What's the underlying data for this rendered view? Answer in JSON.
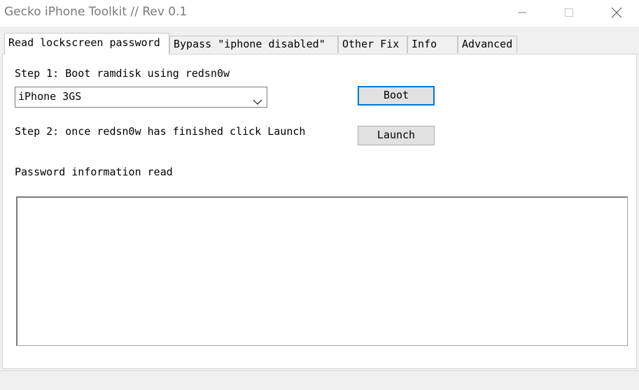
{
  "window": {
    "title": "Gecko iPhone Toolkit // Rev 0.1"
  },
  "tabs": [
    {
      "label": "Read lockscreen password",
      "active": true
    },
    {
      "label": "Bypass \"iphone disabled\"",
      "active": false
    },
    {
      "label": "Other Fix",
      "active": false
    },
    {
      "label": "Info",
      "active": false
    },
    {
      "label": "Advanced",
      "active": false
    }
  ],
  "panel": {
    "step1_label": "Step 1: Boot ramdisk using redsn0w",
    "device_select": {
      "value": "iPhone 3GS"
    },
    "boot_button": "Boot",
    "step2_label": "Step 2: once redsn0w has finished click Launch",
    "launch_button": "Launch",
    "password_label": "Password information read",
    "password_output": ""
  },
  "icons": {
    "minimize": "minimize-icon",
    "maximize": "maximize-icon",
    "close": "close-icon",
    "dropdown": "chevron-down-icon"
  },
  "colors": {
    "accent": "#0078d7",
    "title_text": "#7a7a7a",
    "window_bg": "#f0f0f0"
  }
}
